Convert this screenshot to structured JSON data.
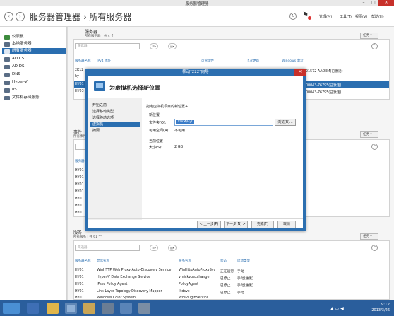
{
  "window": {
    "title": "服务器管理器"
  },
  "header": {
    "title": "服务器管理器 › 所有服务器",
    "menu": [
      "管理(M)",
      "工具(T)",
      "视图(V)",
      "帮助(H)"
    ]
  },
  "sidebar": {
    "items": [
      {
        "label": "仪表板",
        "icon": "dashboard-icon",
        "color": "#3d8b3d"
      },
      {
        "label": "本地服务器",
        "icon": "server-icon",
        "color": "#5a6d85"
      },
      {
        "label": "所有服务器",
        "icon": "servers-icon",
        "color": "#5a6d85"
      },
      {
        "label": "AD CS",
        "icon": "adcs-icon",
        "color": "#5a6d85"
      },
      {
        "label": "AD DS",
        "icon": "adds-icon",
        "color": "#5a6d85"
      },
      {
        "label": "DNS",
        "icon": "dns-icon",
        "color": "#5a6d85"
      },
      {
        "label": "Hyper-V",
        "icon": "hyperv-icon",
        "color": "#5a6d85"
      },
      {
        "label": "IIS",
        "icon": "iis-icon",
        "color": "#5a6d85"
      },
      {
        "label": "文件和存储服务",
        "icon": "storage-icon",
        "color": "#5a6d85"
      }
    ]
  },
  "servers_panel": {
    "title": "服务器",
    "subtitle": "所有服务器 | 共 4 个",
    "filter": "筛选器",
    "tasks": "任务 ▾",
    "columns": [
      "服务器名称",
      "IPv4 地址",
      "可管理性",
      "上次更新",
      "Windows 激活"
    ],
    "rows": [
      {
        "name": "2K12",
        "activation": "21572-AAOEM(已激活)"
      },
      {
        "name": "hy",
        "activation": ""
      },
      {
        "name": "HY01",
        "activation": "00043-76795(已激活)"
      },
      {
        "name": "HY03",
        "activation": "00043-76795(已激活)"
      }
    ]
  },
  "events_panel": {
    "title": "事件",
    "subtitle": "所有事件 | 共",
    "filter": "筛选器",
    "tasks": "任务 ▾",
    "column": "服务器名称",
    "rows": [
      "HY01",
      "HY01",
      "HY01",
      "HY01",
      "HY01",
      "HY01",
      "HY01"
    ]
  },
  "services_panel": {
    "title": "服务",
    "subtitle": "所有服务 | 共 61 个",
    "filter": "筛选器",
    "tasks": "任务 ▾",
    "columns": [
      "服务器名称",
      "显示名称",
      "服务名称",
      "状态",
      "启动类型"
    ],
    "rows": [
      {
        "server": "HY01",
        "display": "WinHTTP Web Proxy Auto-Discovery Service",
        "service": "WinHttpAutoProxySvc",
        "status": "正在运行",
        "start": "手动"
      },
      {
        "server": "HY01",
        "display": "Hyper-V Data Exchange Service",
        "service": "vmickvpexchange",
        "status": "已停止",
        "start": "手动(触发)"
      },
      {
        "server": "HY01",
        "display": "IPsec Policy Agent",
        "service": "PolicyAgent",
        "status": "已停止",
        "start": "手动(触发)"
      },
      {
        "server": "HY01",
        "display": "Link-Layer Topology Discovery Mapper",
        "service": "lltdsvc",
        "status": "已停止",
        "start": "手动"
      },
      {
        "server": "HY01",
        "display": "Windows Color System",
        "service": "WcsPlugInService",
        "status": "已停止",
        "start": "手动"
      }
    ]
  },
  "dialog": {
    "title": "移动\"222\"向导",
    "heading": "为虚拟机选择新位置",
    "nav": [
      "开始之前",
      "选择移动类型",
      "选择移动选项",
      "虚拟机",
      "摘要"
    ],
    "intro": "指定虚拟机项目的新位置+",
    "new_location": "新位置",
    "folder_label": "文件夹(O):",
    "folder_value": "D:\\VM\\Hy0",
    "browse": "浏览(B)...",
    "available_label": "可用空间(A):",
    "available_value": "不可用",
    "current_location": "当前位置",
    "size_label": "大小(S):",
    "size_value": "2 GB",
    "buttons": {
      "prev": "< 上一步(P)",
      "next": "下一步(N) >",
      "finish": "完成(F)",
      "cancel": "取消"
    }
  },
  "taskbar": {
    "time": "9:12",
    "date": "2013/3/26"
  }
}
